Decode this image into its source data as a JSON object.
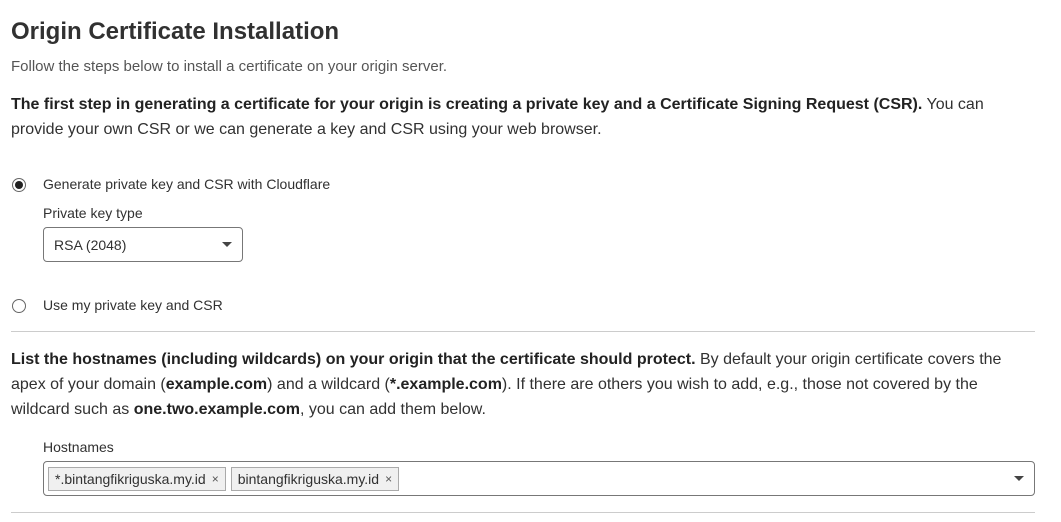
{
  "header": {
    "title": "Origin Certificate Installation",
    "subtitle": "Follow the steps below to install a certificate on your origin server."
  },
  "step1": {
    "bold": "The first step in generating a certificate for your origin is creating a private key and a Certificate Signing Request (CSR).",
    "rest": " You can provide your own CSR or we can generate a key and CSR using your web browser."
  },
  "options": {
    "generate": {
      "label": "Generate private key and CSR with Cloudflare",
      "selected": true
    },
    "key_type_label": "Private key type",
    "key_type_value": "RSA (2048)",
    "own": {
      "label": "Use my private key and CSR",
      "selected": false
    }
  },
  "step2": {
    "bold": "List the hostnames (including wildcards) on your origin that the certificate should protect.",
    "t1": " By default your origin certificate covers the apex of your domain (",
    "b1": "example.com",
    "t2": ") and a wildcard (",
    "b2": "*.example.com",
    "t3": "). If there are others you wish to add, e.g., those not covered by the wildcard such as ",
    "b3": "one.two.example.com",
    "t4": ", you can add them below."
  },
  "hostnames": {
    "label": "Hostnames",
    "tags": [
      "*.bintangfikriguska.my.id",
      "bintangfikriguska.my.id"
    ],
    "remove": "×"
  }
}
